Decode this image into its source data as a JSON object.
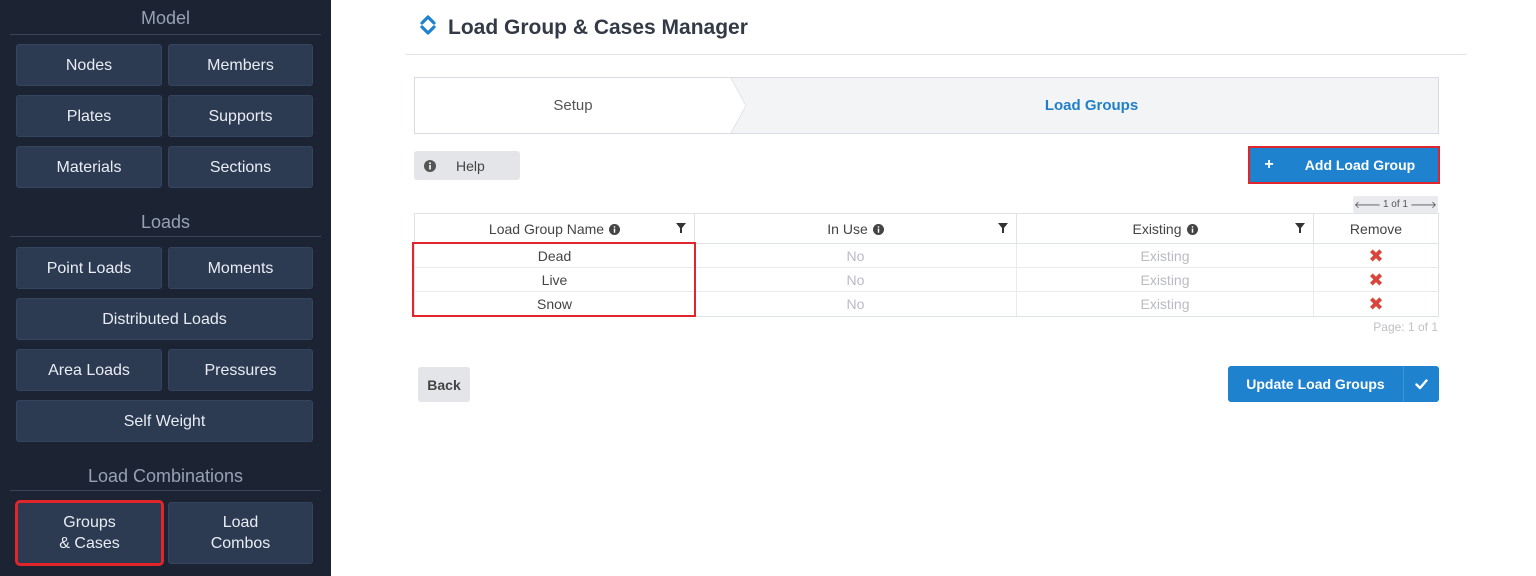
{
  "sidebar": {
    "sections": {
      "model": "Model",
      "loads": "Loads",
      "load_combinations": "Load Combinations"
    },
    "buttons": {
      "nodes": "Nodes",
      "members": "Members",
      "plates": "Plates",
      "supports": "Supports",
      "materials": "Materials",
      "sections": "Sections",
      "point_loads": "Point Loads",
      "moments": "Moments",
      "distributed_loads": "Distributed Loads",
      "area_loads": "Area Loads",
      "pressures": "Pressures",
      "self_weight": "Self Weight",
      "groups_cases_line1": "Groups",
      "groups_cases_line2": "& Cases",
      "load_combos_line1": "Load",
      "load_combos_line2": "Combos"
    }
  },
  "header": {
    "title": "Load Group & Cases Manager"
  },
  "steps": {
    "setup": "Setup",
    "load_groups": "Load Groups"
  },
  "toolbar": {
    "help": "Help",
    "add_load_group": "Add Load Group"
  },
  "pager": {
    "top": "1 of 1",
    "bottom": "Page: 1 of 1"
  },
  "table": {
    "columns": {
      "name": "Load Group Name",
      "in_use": "In Use",
      "existing": "Existing",
      "remove": "Remove"
    },
    "rows": [
      {
        "name": "Dead",
        "in_use": "No",
        "existing": "Existing",
        "remove": "✖"
      },
      {
        "name": "Live",
        "in_use": "No",
        "existing": "Existing",
        "remove": "✖"
      },
      {
        "name": "Snow",
        "in_use": "No",
        "existing": "Existing",
        "remove": "✖"
      }
    ]
  },
  "footer": {
    "back": "Back",
    "update": "Update Load Groups"
  },
  "colors": {
    "sidebar_bg": "#1c2434",
    "sidebar_button": "#2c3a52",
    "primary": "#1f82cf",
    "highlight": "#e0262b",
    "remove_icon": "#d9443b"
  },
  "icons": {
    "title": "refresh-icon",
    "help": "info-icon",
    "add": "plus-icon",
    "filter": "filter-icon",
    "remove": "close-icon",
    "update": "check-icon",
    "pager_prev": "arrow-left-icon",
    "pager_next": "arrow-right-icon"
  }
}
